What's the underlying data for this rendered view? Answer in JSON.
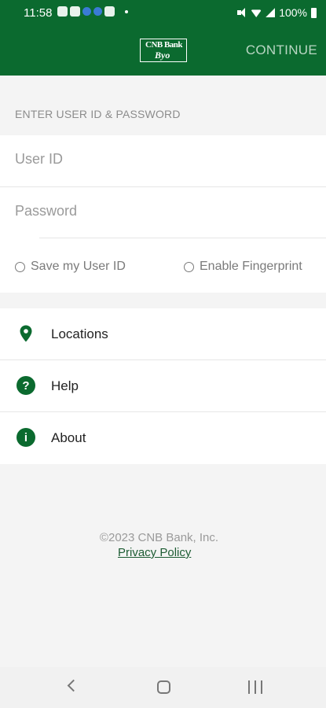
{
  "status_bar": {
    "time": "11:58",
    "battery": "100%",
    "icons": [
      "weather-icon",
      "calendar-icon",
      "app-icon",
      "app-icon",
      "app-icon",
      "mute-icon",
      "wifi-icon",
      "signal-icon",
      "battery-icon"
    ]
  },
  "header": {
    "logo_text_top": "CNB Bank",
    "logo_text_bottom": "Byo",
    "continue_label": "CONTINUE",
    "background_color": "#0b6a2f"
  },
  "login": {
    "section_label": "ENTER USER ID & PASSWORD",
    "user_id_placeholder": "User ID",
    "password_placeholder": "Password",
    "save_user_id_label": "Save my User ID",
    "enable_fingerprint_label": "Enable Fingerprint"
  },
  "menu": {
    "items": [
      {
        "label": "Locations",
        "icon": "location-pin-icon"
      },
      {
        "label": "Help",
        "icon": "question-icon"
      },
      {
        "label": "About",
        "icon": "info-icon"
      }
    ]
  },
  "footer": {
    "copyright": "©2023 CNB Bank, Inc.",
    "privacy_label": "Privacy Policy"
  },
  "colors": {
    "brand_green": "#0b6a2f",
    "link_green": "#1d5c33"
  }
}
